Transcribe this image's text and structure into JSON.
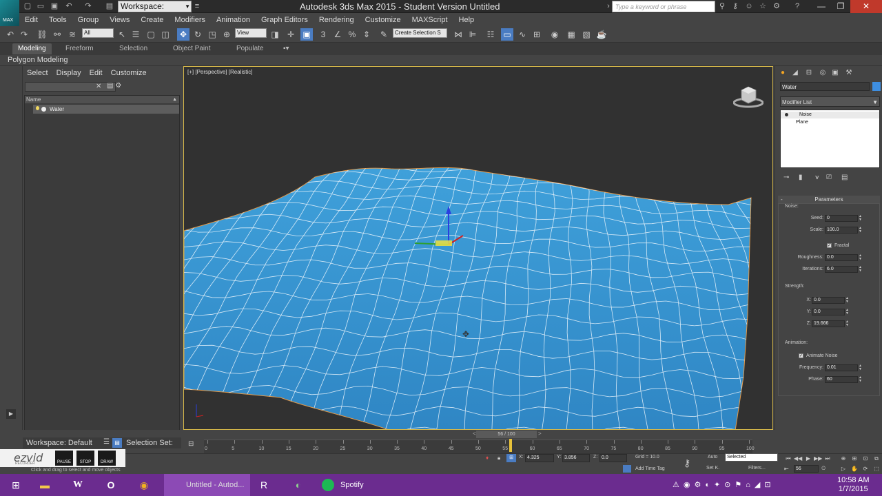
{
  "titlebar": {
    "workspace": "Workspace: Default",
    "title": "Autodesk 3ds Max  2015   - Student Version    Untitled",
    "search_placeholder": "Type a keyword or phrase"
  },
  "menu": [
    "Edit",
    "Tools",
    "Group",
    "Views",
    "Create",
    "Modifiers",
    "Animation",
    "Graph Editors",
    "Rendering",
    "Customize",
    "MAXScript",
    "Help"
  ],
  "toolbar": {
    "selection_filter": "All",
    "ref_coord": "View",
    "named_selection": "Create Selection S"
  },
  "ribbon": {
    "tabs": [
      "Modeling",
      "Freeform",
      "Selection",
      "Object Paint",
      "Populate"
    ],
    "active": "Modeling",
    "sub_label": "Polygon Modeling"
  },
  "scene_explorer": {
    "menu": [
      "Select",
      "Display",
      "Edit",
      "Customize"
    ],
    "column": "Name",
    "items": [
      "Water"
    ]
  },
  "viewport": {
    "label": "[+] [Perspective] [Realistic]"
  },
  "command_panel": {
    "object_name": "Water",
    "object_color": "#3e8ee0",
    "modifier_list": "Modifier List",
    "stack": [
      "Noise",
      "Plane"
    ],
    "rollout": "Parameters",
    "noise_group": "Noise:",
    "seed_label": "Seed:",
    "seed": "0",
    "scale_label": "Scale:",
    "scale": "100.0",
    "fractal_label": "Fractal",
    "fractal_checked": true,
    "roughness_label": "Roughness:",
    "roughness": "0.0",
    "iterations_label": "Iterations:",
    "iterations": "6.0",
    "strength_group": "Strength:",
    "x_label": "X:",
    "x": "0.0",
    "y_label": "Y:",
    "y": "0.0",
    "z_label": "Z:",
    "z": "19.666",
    "animation_group": "Animation:",
    "animate_noise_label": "Animate Noise",
    "animate_noise_checked": true,
    "frequency_label": "Frequency:",
    "frequency": "0.01",
    "phase_label": "Phase:",
    "phase": "60"
  },
  "timeline": {
    "slider": "56 / 100",
    "ticks": [
      "0",
      "5",
      "10",
      "15",
      "20",
      "25",
      "30",
      "35",
      "40",
      "45",
      "50",
      "55",
      "60",
      "65",
      "70",
      "75",
      "80",
      "85",
      "90",
      "95",
      "100"
    ],
    "current_frame": 56,
    "frame_box": "56"
  },
  "bottom": {
    "workspace": "Workspace: Default",
    "selection_set": "Selection Set:",
    "prompt": "Click and drag to select and move objects",
    "x_label": "X:",
    "x": "4.325",
    "y_label": "Y:",
    "y": "3.856",
    "z_label": "Z:",
    "z": "0.0",
    "grid": "Grid = 10.0",
    "add_time_tag": "Add Time Tag",
    "auto": "Auto",
    "set_key": "Set K.",
    "key_filter": "Selected",
    "filters": "Filters..."
  },
  "ezvid": {
    "logo": "ezvid",
    "sub": "RECORDER",
    "buttons": [
      "PAUSE",
      "STOP",
      "DRAW"
    ]
  },
  "taskbar": {
    "max_window": "Untitled - Autod...",
    "spotify": "Spotify",
    "time": "10:58 AM",
    "date": "1/7/2015"
  }
}
